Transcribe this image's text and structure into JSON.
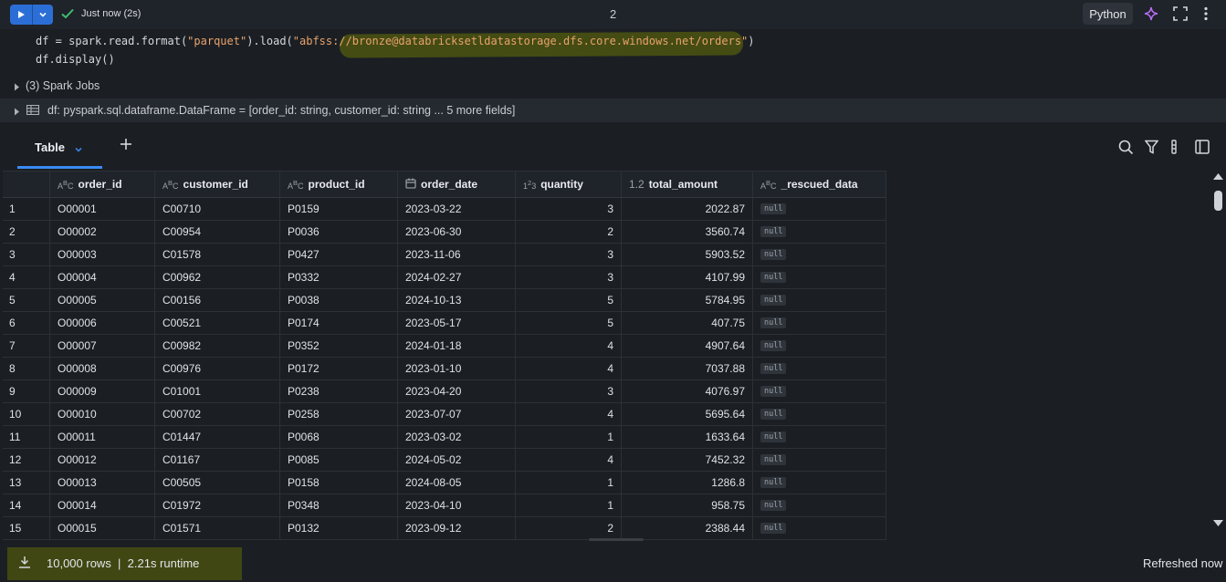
{
  "toolbar": {
    "status": "Just now (2s)",
    "cell_number": "2",
    "language": "Python"
  },
  "code": {
    "line1_prefix": "df = spark.read.format(",
    "line1_str1": "\"parquet\"",
    "line1_mid": ").load(",
    "line1_str2": "\"abfss://bronze@databricksetldatastorage.dfs.core.windows.net/orders\"",
    "line1_suffix": ")",
    "line2": "df.display()"
  },
  "spark_jobs": "(3) Spark Jobs",
  "df_info": "df:  pyspark.sql.dataframe.DataFrame = [order_id: string, customer_id: string ... 5 more fields]",
  "tabs": [
    {
      "label": "Table"
    }
  ],
  "table": {
    "headers": [
      {
        "icon": "ABC",
        "label": "order_id"
      },
      {
        "icon": "ABC",
        "label": "customer_id"
      },
      {
        "icon": "ABC",
        "label": "product_id"
      },
      {
        "icon": "calendar",
        "label": "order_date"
      },
      {
        "icon": "123",
        "label": "quantity"
      },
      {
        "icon": "1.2",
        "label": "total_amount"
      },
      {
        "icon": "ABC",
        "label": "_rescued_data"
      }
    ],
    "rows": [
      [
        "1",
        "O00001",
        "C00710",
        "P0159",
        "2023-03-22",
        "3",
        "2022.87",
        "null"
      ],
      [
        "2",
        "O00002",
        "C00954",
        "P0036",
        "2023-06-30",
        "2",
        "3560.74",
        "null"
      ],
      [
        "3",
        "O00003",
        "C01578",
        "P0427",
        "2023-11-06",
        "3",
        "5903.52",
        "null"
      ],
      [
        "4",
        "O00004",
        "C00962",
        "P0332",
        "2024-02-27",
        "3",
        "4107.99",
        "null"
      ],
      [
        "5",
        "O00005",
        "C00156",
        "P0038",
        "2024-10-13",
        "5",
        "5784.95",
        "null"
      ],
      [
        "6",
        "O00006",
        "C00521",
        "P0174",
        "2023-05-17",
        "5",
        "407.75",
        "null"
      ],
      [
        "7",
        "O00007",
        "C00982",
        "P0352",
        "2024-01-18",
        "4",
        "4907.64",
        "null"
      ],
      [
        "8",
        "O00008",
        "C00976",
        "P0172",
        "2023-01-10",
        "4",
        "7037.88",
        "null"
      ],
      [
        "9",
        "O00009",
        "C01001",
        "P0238",
        "2023-04-20",
        "3",
        "4076.97",
        "null"
      ],
      [
        "10",
        "O00010",
        "C00702",
        "P0258",
        "2023-07-07",
        "4",
        "5695.64",
        "null"
      ],
      [
        "11",
        "O00011",
        "C01447",
        "P0068",
        "2023-03-02",
        "1",
        "1633.64",
        "null"
      ],
      [
        "12",
        "O00012",
        "C01167",
        "P0085",
        "2024-05-02",
        "4",
        "7452.32",
        "null"
      ],
      [
        "13",
        "O00013",
        "C00505",
        "P0158",
        "2024-08-05",
        "1",
        "1286.8",
        "null"
      ],
      [
        "14",
        "O00014",
        "C01972",
        "P0348",
        "2023-04-10",
        "1",
        "958.75",
        "null"
      ],
      [
        "15",
        "O00015",
        "C01571",
        "P0132",
        "2023-09-12",
        "2",
        "2388.44",
        "null"
      ]
    ]
  },
  "footer": {
    "rows_runtime": "10,000 rows  |  2.21s runtime",
    "refreshed": "Refreshed now"
  },
  "colors": {
    "accent": "#2b6fd6",
    "highlight": "#6e7800",
    "tab_underline": "#3b8bf5"
  }
}
